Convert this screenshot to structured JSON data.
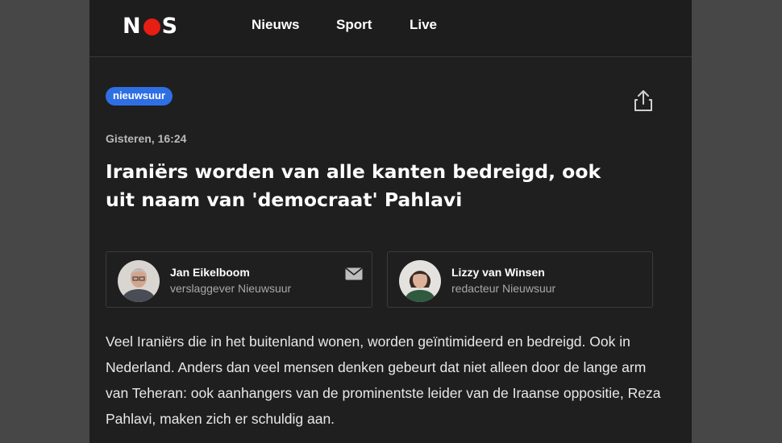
{
  "header": {
    "logo": "NOS",
    "nav": [
      "Nieuws",
      "Sport",
      "Live"
    ]
  },
  "article": {
    "tag": "nieuwsuur",
    "timestamp": "Gisteren, 16:24",
    "headline": "Iraniërs worden van alle kanten bedreigd, ook uit naam van 'democraat' Pahlavi",
    "authors": [
      {
        "name": "Jan Eikelboom",
        "role": "verslaggever Nieuwsuur"
      },
      {
        "name": "Lizzy van Winsen",
        "role": "redacteur Nieuwsuur"
      }
    ],
    "lead": "Veel Iraniërs die in het buitenland wonen, worden geïntimideerd en bedreigd. Ook in Nederland. Anders dan veel mensen denken gebeurt dat niet alleen door de lange arm van Teheran: ook aanhangers van de prominentste leider van de Iraanse oppositie, Reza Pahlavi, maken zich er schuldig aan."
  },
  "icons": {
    "share": "share-icon",
    "mail": "mail-icon"
  },
  "colors": {
    "brand": "#e61e14",
    "tag": "#2f6fe4",
    "background": "#1f1f1f",
    "outer": "#474747"
  }
}
